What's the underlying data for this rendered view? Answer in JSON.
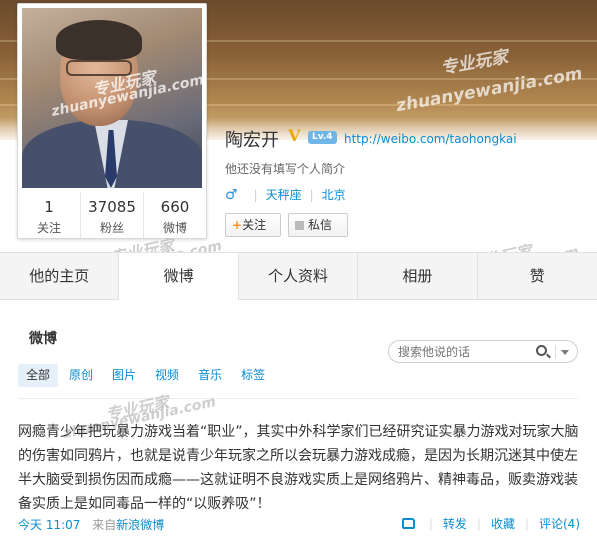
{
  "profile": {
    "name": "陶宏开",
    "verified_mark": "V",
    "level": "Lv.4",
    "url": "http://weibo.com/taohongkai",
    "bio": "他还没有填写个人简介",
    "gender_icon": "male-icon",
    "constellation": "天秤座",
    "location": "北京",
    "follow_label": "关注",
    "message_label": "私信",
    "stats": [
      {
        "num": "1",
        "label": "关注"
      },
      {
        "num": "37085",
        "label": "粉丝"
      },
      {
        "num": "660",
        "label": "微博"
      }
    ]
  },
  "tabs": [
    "他的主页",
    "微博",
    "个人资料",
    "相册",
    "赞"
  ],
  "active_tab": 1,
  "feed": {
    "title": "微博",
    "search_placeholder": "搜索他说的话",
    "filters": [
      "全部",
      "原创",
      "图片",
      "视频",
      "音乐",
      "标签"
    ]
  },
  "post": {
    "text": "网瘾青少年把玩暴力游戏当着“职业”，其实中外科学家们已经研究证实暴力游戏对玩家大脑的伤害如同鸦片，也就是说青少年玩家之所以会玩暴力游戏成瘾，是因为长期沉迷其中使左半大脑受到损伤因而成瘾——这就证明不良游戏实质上是网络鸦片、精神毒品，贩卖游戏装备实质上是如同毒品一样的“以贩养吸”！",
    "time": "今天 11:07",
    "source_prefix": "来自",
    "source": "新浪微博",
    "repost": "转发",
    "favorite": "收藏",
    "comment": "评论(4)"
  },
  "watermark": {
    "cn": "专业玩家",
    "en": "zhuanyewanjia.com"
  },
  "colors": {
    "link": "#0a8cd2",
    "verified": "#e8a900",
    "tab_bg": "#f4f4f4"
  }
}
